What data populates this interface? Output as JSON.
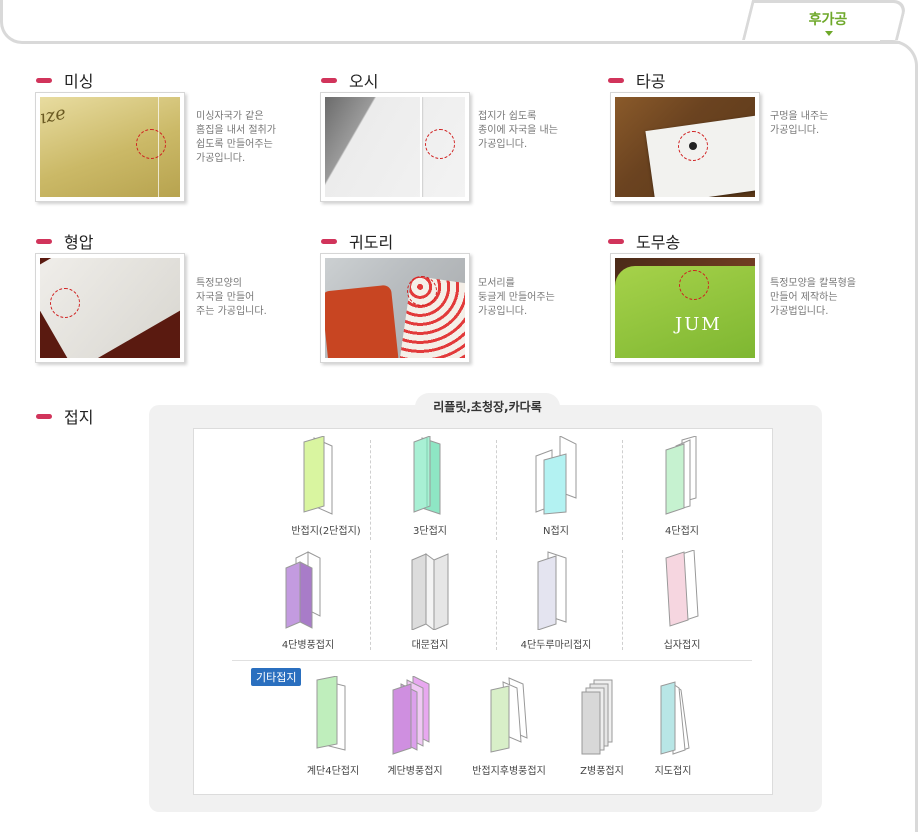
{
  "tab": {
    "label": "후가공"
  },
  "sections": [
    {
      "title": "미싱",
      "desc": [
        "미싱자국가 같은",
        "홈집을 내서 절취가",
        "쉽도록 만들어주는",
        "가공입니다."
      ]
    },
    {
      "title": "오시",
      "desc": [
        "접지가 쉽도록",
        "종이에 자국을 내는",
        "가공입니다."
      ]
    },
    {
      "title": "타공",
      "desc": [
        "구멍을 내주는",
        "가공입니다."
      ]
    },
    {
      "title": "형압",
      "desc": [
        "특정모양의",
        "자국을 만들어",
        "주는 가공입니다."
      ]
    },
    {
      "title": "귀도리",
      "desc": [
        "모서리를",
        "둥글게 만들어주는",
        "가공입니다."
      ]
    },
    {
      "title": "도무송",
      "desc": [
        "특정모양을 칼목형을",
        "만들어 제작하는",
        "가공법입니다."
      ]
    }
  ],
  "fold": {
    "title": "접지",
    "heading": "리플릿,초청장,카다록",
    "row1": [
      {
        "label": "반접지(2단접지)",
        "color": "#d9f5a0"
      },
      {
        "label": "3단접지",
        "color": "#a8f0d4"
      },
      {
        "label": "N접지",
        "color": "#b3f2f2"
      },
      {
        "label": "4단접지",
        "color": "#c6f2d0"
      }
    ],
    "row2": [
      {
        "label": "4단병풍접지",
        "color": "#c39be0"
      },
      {
        "label": "대문접지",
        "color": "#dcdcdc"
      },
      {
        "label": "4단두루마리접지",
        "color": "#e4e4f0"
      },
      {
        "label": "십자접지",
        "color": "#f6d6e0"
      }
    ],
    "other_tag": "기타접지",
    "other": [
      {
        "label": "계단4단접지",
        "color": "#bfeebc"
      },
      {
        "label": "계단병풍접지",
        "color": "#cf8fe0"
      },
      {
        "label": "반접지후병풍접지",
        "color": "#d8efc8"
      },
      {
        "label": "Z병풍접지",
        "color": "#d8d8d8"
      },
      {
        "label": "지도접지",
        "color": "#b8e6e6"
      }
    ]
  }
}
